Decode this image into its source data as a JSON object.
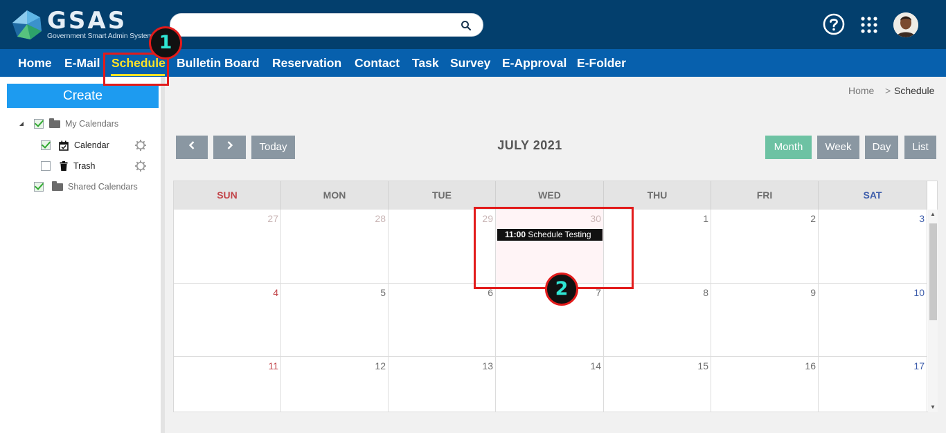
{
  "app": {
    "logo_text": "GSAS",
    "logo_sub": "Government Smart Admin System"
  },
  "search": {
    "placeholder": ""
  },
  "topbar_icons": [
    "help-circle-icon",
    "apps-grid-icon",
    "user-avatar"
  ],
  "nav": {
    "items": [
      "Home",
      "E-Mail",
      "Schedule",
      "Bulletin Board",
      "Reservation",
      "Contact",
      "Task",
      "Survey",
      "E-Approval",
      "E-Folder"
    ],
    "active": "Schedule"
  },
  "annotations": {
    "badge1": "1",
    "badge2": "2",
    "color": "#e21b1b"
  },
  "sidebar": {
    "create_label": "Create",
    "tree": {
      "my_calendars": "My Calendars",
      "calendar": "Calendar",
      "trash": "Trash",
      "shared_calendars": "Shared Calendars"
    }
  },
  "breadcrumb": {
    "home": "Home",
    "separator": ">",
    "current": "Schedule"
  },
  "toolbar": {
    "prev": "<",
    "next": ">",
    "today": "Today",
    "month_title": "JULY 2021",
    "views": [
      "Month",
      "Week",
      "Day",
      "List"
    ],
    "active_view": "Month"
  },
  "calendar": {
    "weekdays": [
      "SUN",
      "MON",
      "TUE",
      "WED",
      "THU",
      "FRI",
      "SAT"
    ],
    "weeks": [
      [
        {
          "d": "27",
          "other": true
        },
        {
          "d": "28",
          "other": true
        },
        {
          "d": "29",
          "other": true
        },
        {
          "d": "30",
          "other": true,
          "today": true
        },
        {
          "d": "1"
        },
        {
          "d": "2"
        },
        {
          "d": "3"
        }
      ],
      [
        {
          "d": "4"
        },
        {
          "d": "5"
        },
        {
          "d": "6"
        },
        {
          "d": "7"
        },
        {
          "d": "8"
        },
        {
          "d": "9"
        },
        {
          "d": "10"
        }
      ],
      [
        {
          "d": "11"
        },
        {
          "d": "12"
        },
        {
          "d": "13"
        },
        {
          "d": "14"
        },
        {
          "d": "15"
        },
        {
          "d": "16"
        },
        {
          "d": "17"
        }
      ]
    ],
    "event": {
      "time": "11:00",
      "title": "Schedule Testing",
      "day": "30"
    }
  },
  "colors": {
    "topbar": "#033f6d",
    "navbar": "#0760ad",
    "nav_active": "#ffe227",
    "create": "#1d9bf0",
    "view_active": "#6dc2a3",
    "button": "#8a97a2",
    "sunday": "#c2454a",
    "saturday": "#3d5dab"
  }
}
